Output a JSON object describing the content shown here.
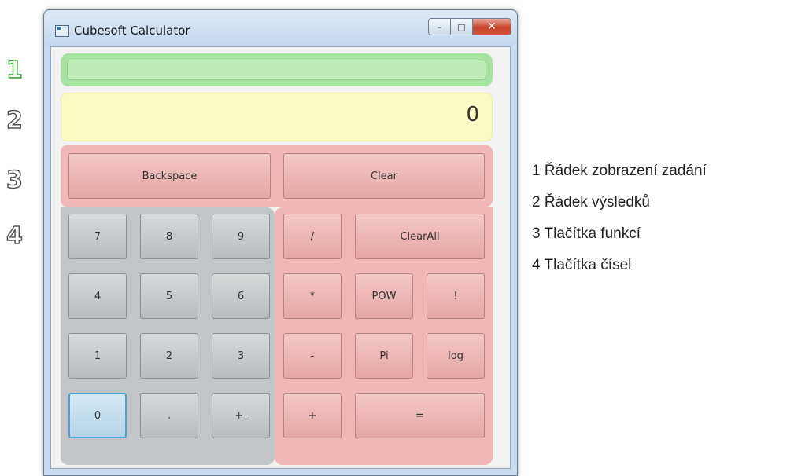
{
  "markers": [
    "1",
    "2",
    "3",
    "4"
  ],
  "window": {
    "title": "Cubesoft Calculator",
    "caption": {
      "minimize": "–",
      "maximize": "□",
      "close": "✕"
    }
  },
  "display": {
    "input": "",
    "result": "0"
  },
  "function_buttons": {
    "backspace": "Backspace",
    "clear": "Clear"
  },
  "number_buttons": {
    "n7": "7",
    "n8": "8",
    "n9": "9",
    "n4": "4",
    "n5": "5",
    "n6": "6",
    "n1": "1",
    "n2": "2",
    "n3": "3",
    "n0": "0",
    "dot": ".",
    "sign": "+-"
  },
  "operator_buttons": {
    "divide": "/",
    "clearall": "ClearAll",
    "multiply": "*",
    "pow": "POW",
    "factorial": "!",
    "minus": "-",
    "pi": "Pi",
    "log": "log",
    "plus": "+",
    "equals": "="
  },
  "legend": [
    "1 Řádek zobrazení zadání",
    "2 Řádek výsledků",
    "3 Tlačítka funkcí",
    "4 Tlačítka čísel"
  ],
  "colors": {
    "input_zone": "#a6e3a0",
    "result_zone": "#fbf9c3",
    "function_zone": "#f2b6b6",
    "number_zone": "#c2c6c8",
    "focus_border": "#4aa3d3"
  },
  "icons": {
    "app": "calculator-window-icon",
    "minimize": "minimize-icon",
    "maximize": "maximize-icon",
    "close": "close-icon"
  }
}
